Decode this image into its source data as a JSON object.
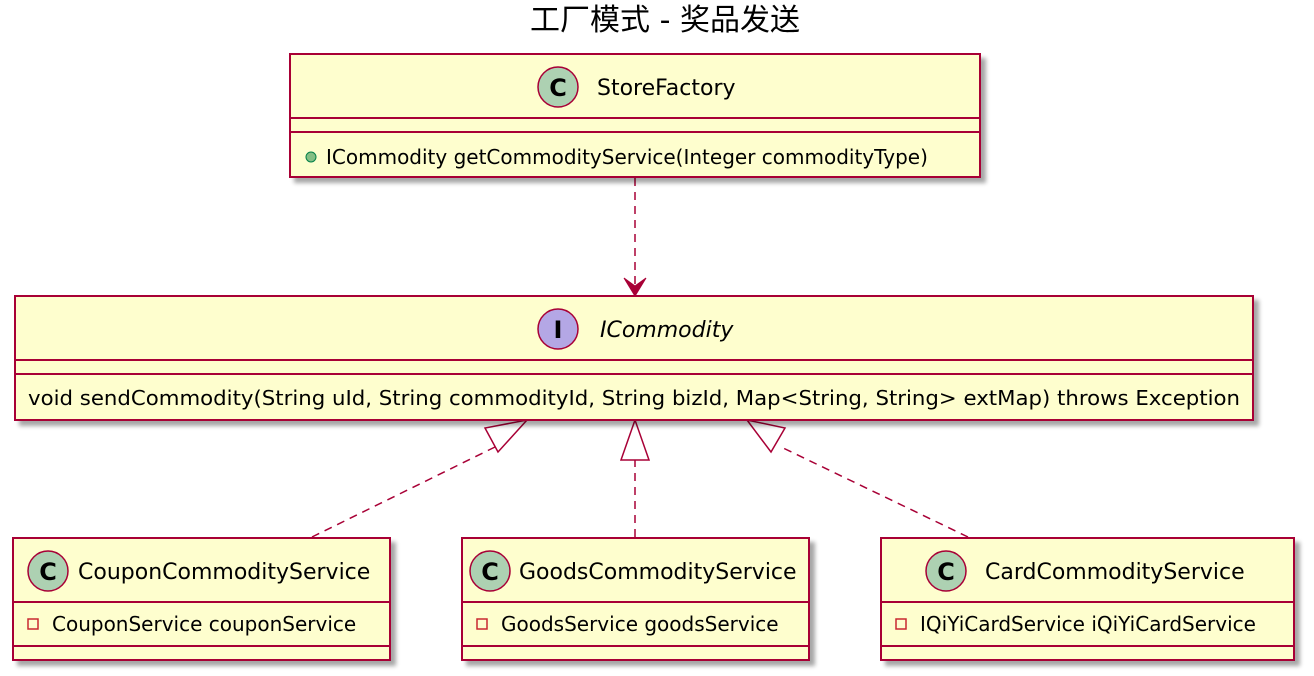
{
  "title": "工厂模式 - 奖品发送",
  "colors": {
    "box_fill": "#FEFECE",
    "box_border": "#A80036",
    "class_badge": "#ADD1B2",
    "interface_badge": "#B4A7E5",
    "public_marker": "#84BE84",
    "private_marker": "#C82930"
  },
  "classes": {
    "store_factory": {
      "kind": "class",
      "badge": "C",
      "name": "StoreFactory",
      "members": [
        {
          "visibility": "public",
          "text": "ICommodity getCommodityService(Integer commodityType)"
        }
      ]
    },
    "icommodity": {
      "kind": "interface",
      "badge": "I",
      "name": "ICommodity",
      "members": [
        {
          "visibility": "none",
          "text": "void sendCommodity(String uId, String commodityId, String bizId, Map<String, String> extMap) throws Exception"
        }
      ]
    },
    "coupon": {
      "kind": "class",
      "badge": "C",
      "name": "CouponCommodityService",
      "members": [
        {
          "visibility": "private",
          "text": "CouponService couponService"
        }
      ]
    },
    "goods": {
      "kind": "class",
      "badge": "C",
      "name": "GoodsCommodityService",
      "members": [
        {
          "visibility": "private",
          "text": "GoodsService goodsService"
        }
      ]
    },
    "card": {
      "kind": "class",
      "badge": "C",
      "name": "CardCommodityService",
      "members": [
        {
          "visibility": "private",
          "text": "IQiYiCardService iQiYiCardService"
        }
      ]
    }
  },
  "relations": [
    {
      "from": "StoreFactory",
      "to": "ICommodity",
      "type": "dependency"
    },
    {
      "from": "CouponCommodityService",
      "to": "ICommodity",
      "type": "realization"
    },
    {
      "from": "GoodsCommodityService",
      "to": "ICommodity",
      "type": "realization"
    },
    {
      "from": "CardCommodityService",
      "to": "ICommodity",
      "type": "realization"
    }
  ]
}
